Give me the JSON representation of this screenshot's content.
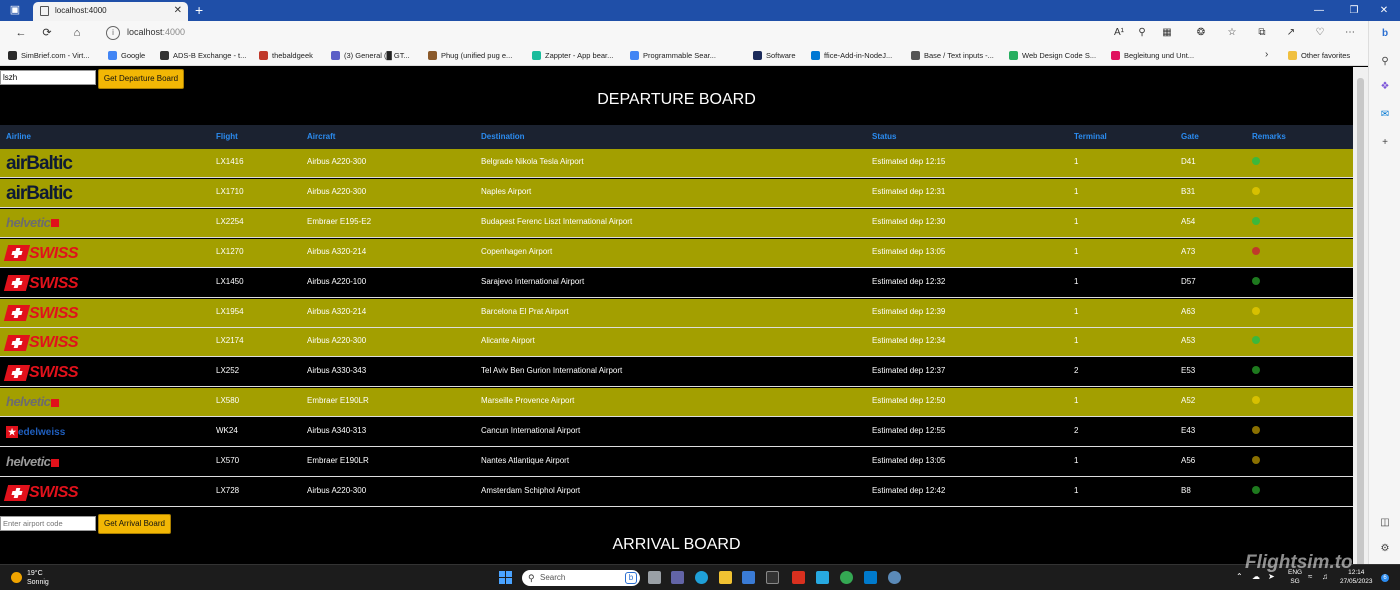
{
  "browser": {
    "tab_title": "localhost:4000",
    "url_host": "localhost",
    "url_port": ":4000",
    "bookmarks": [
      {
        "label": "SimBrief.com - Virt...",
        "icon": "simbrief-icon",
        "color": "#2a2a2a"
      },
      {
        "label": "Google",
        "icon": "google-icon",
        "color": "#4285f4"
      },
      {
        "label": "ADS-B Exchange - t...",
        "icon": "adsb-icon",
        "color": "#333333"
      },
      {
        "label": "thebaldgeek",
        "icon": "thebaldgeek-icon",
        "color": "#c0392b"
      },
      {
        "label": "(3) General (█ GT...",
        "icon": "teams-icon",
        "color": "#5b5fc7"
      },
      {
        "label": "Phug (unified pug e...",
        "icon": "pug-icon",
        "color": "#8b5a2b"
      },
      {
        "label": "Zappter - App bear...",
        "icon": "zappter-icon",
        "color": "#1abc9c"
      },
      {
        "label": "Programmable Sear...",
        "icon": "google-icon",
        "color": "#4285f4"
      },
      {
        "label": "Software",
        "icon": "software-icon",
        "color": "#1b2a5a"
      },
      {
        "label": "ffice-Add-in-NodeJ...",
        "icon": "azure-icon",
        "color": "#0078d4"
      },
      {
        "label": "Base / Text inputs -...",
        "icon": "page-icon",
        "color": "#555555"
      },
      {
        "label": "Web Design Code S...",
        "icon": "webdesign-icon",
        "color": "#27ae60"
      },
      {
        "label": "Begleitung und Unt...",
        "icon": "begleitung-icon",
        "color": "#e0115f"
      },
      {
        "label": "Other favorites",
        "icon": "folder-icon",
        "color": "#f0c040"
      }
    ]
  },
  "departure": {
    "airport_value": "lszh",
    "button_label": "Get Departure Board",
    "title": "DEPARTURE BOARD",
    "columns": [
      "Airline",
      "Flight",
      "Aircraft",
      "Destination",
      "Status",
      "Terminal",
      "Gate",
      "Remarks"
    ],
    "rows": [
      {
        "airline": "airBaltic",
        "logo": "airbaltic",
        "flight": "LX1416",
        "aircraft": "Airbus A220-300",
        "destination": "Belgrade Nikola Tesla Airport",
        "status": "Estimated dep 12:15",
        "terminal": "1",
        "gate": "D41",
        "remark_color": "#3cb83c",
        "bg": "olive"
      },
      {
        "airline": "airBaltic",
        "logo": "airbaltic",
        "flight": "LX1710",
        "aircraft": "Airbus A220-300",
        "destination": "Naples Airport",
        "status": "Estimated dep 12:31",
        "terminal": "1",
        "gate": "B31",
        "remark_color": "#d7c000",
        "bg": "olive"
      },
      {
        "airline": "helvetic",
        "logo": "helvetic",
        "flight": "LX2254",
        "aircraft": "Embraer E195-E2",
        "destination": "Budapest Ferenc Liszt International Airport",
        "status": "Estimated dep 12:30",
        "terminal": "1",
        "gate": "A54",
        "remark_color": "#3cb83c",
        "bg": "olive"
      },
      {
        "airline": "SWISS",
        "logo": "swiss",
        "flight": "LX1270",
        "aircraft": "Airbus A320-214",
        "destination": "Copenhagen Airport",
        "status": "Estimated dep 13:05",
        "terminal": "1",
        "gate": "A73",
        "remark_color": "#c0392b",
        "bg": "olive"
      },
      {
        "airline": "SWISS",
        "logo": "swiss",
        "flight": "LX1450",
        "aircraft": "Airbus A220-100",
        "destination": "Sarajevo International Airport",
        "status": "Estimated dep 12:32",
        "terminal": "1",
        "gate": "D57",
        "remark_color": "#1e7a1e",
        "bg": "black"
      },
      {
        "airline": "SWISS",
        "logo": "swiss",
        "flight": "LX1954",
        "aircraft": "Airbus A320-214",
        "destination": "Barcelona El Prat Airport",
        "status": "Estimated dep 12:39",
        "terminal": "1",
        "gate": "A63",
        "remark_color": "#d7c000",
        "bg": "olive"
      },
      {
        "airline": "SWISS",
        "logo": "swiss",
        "flight": "LX2174",
        "aircraft": "Airbus A220-300",
        "destination": "Alicante Airport",
        "status": "Estimated dep 12:34",
        "terminal": "1",
        "gate": "A53",
        "remark_color": "#3cb83c",
        "bg": "olive"
      },
      {
        "airline": "SWISS",
        "logo": "swiss",
        "flight": "LX252",
        "aircraft": "Airbus A330-343",
        "destination": "Tel Aviv Ben Gurion International Airport",
        "status": "Estimated dep 12:37",
        "terminal": "2",
        "gate": "E53",
        "remark_color": "#1e7a1e",
        "bg": "black"
      },
      {
        "airline": "helvetic",
        "logo": "helvetic",
        "flight": "LX580",
        "aircraft": "Embraer E190LR",
        "destination": "Marseille Provence Airport",
        "status": "Estimated dep 12:50",
        "terminal": "1",
        "gate": "A52",
        "remark_color": "#d7c000",
        "bg": "olive"
      },
      {
        "airline": "edelweiss",
        "logo": "edelweiss",
        "flight": "WK24",
        "aircraft": "Airbus A340-313",
        "destination": "Cancun International Airport",
        "status": "Estimated dep 12:55",
        "terminal": "2",
        "gate": "E43",
        "remark_color": "#8a7000",
        "bg": "black"
      },
      {
        "airline": "helvetic",
        "logo": "helvetic",
        "flight": "LX570",
        "aircraft": "Embraer E190LR",
        "destination": "Nantes Atlantique Airport",
        "status": "Estimated dep 13:05",
        "terminal": "1",
        "gate": "A56",
        "remark_color": "#8a7000",
        "bg": "black"
      },
      {
        "airline": "SWISS",
        "logo": "swiss",
        "flight": "LX728",
        "aircraft": "Airbus A220-300",
        "destination": "Amsterdam Schiphol Airport",
        "status": "Estimated dep 12:42",
        "terminal": "1",
        "gate": "B8",
        "remark_color": "#1e7a1e",
        "bg": "black"
      }
    ]
  },
  "arrival": {
    "placeholder": "Enter airport code",
    "button_label": "Get Arrival Board",
    "title": "ARRIVAL BOARD"
  },
  "taskbar": {
    "temperature": "19°C",
    "weather_text": "Sonnig",
    "search_placeholder": "Search",
    "lang_top": "ENG",
    "lang_bottom": "SG",
    "time": "12:14",
    "date": "27/05/2023",
    "notification_count": "6"
  },
  "watermark": "Flightsim.to"
}
